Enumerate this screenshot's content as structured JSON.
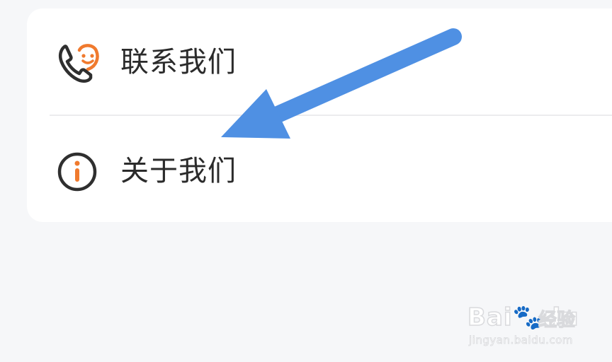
{
  "menu": {
    "items": [
      {
        "label": "联系我们",
        "icon": "phone-smile-icon"
      },
      {
        "label": "关于我们",
        "icon": "info-icon"
      }
    ]
  },
  "annotation": {
    "arrow_color": "#4f90e3",
    "points_to": "关于我们"
  },
  "watermark": {
    "brand": "Bai",
    "brand_suffix": "du",
    "cn": "经验",
    "url": "jingyan.baidu.com"
  },
  "colors": {
    "accent_orange": "#f07a2e",
    "icon_dark": "#2f2f2f",
    "background": "#f6f7f9",
    "card": "#ffffff"
  }
}
